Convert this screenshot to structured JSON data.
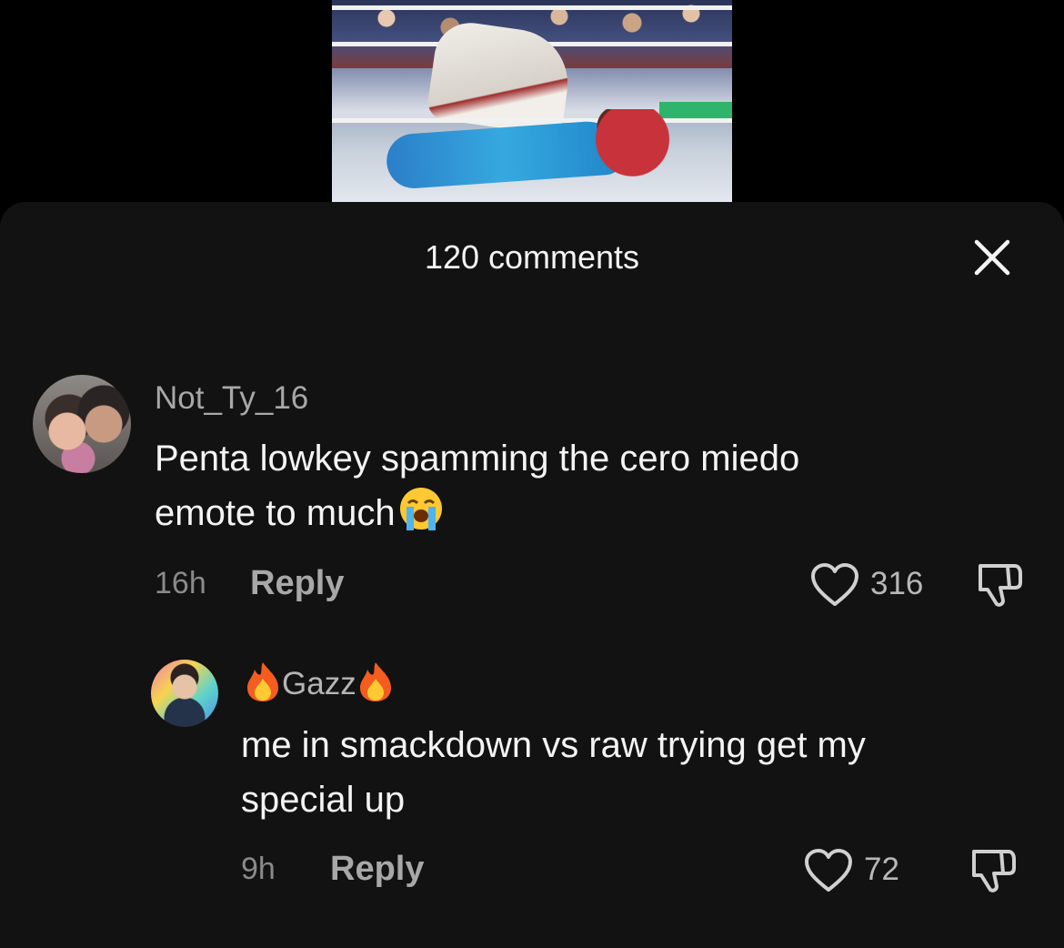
{
  "header": {
    "comment_count": "120 comments"
  },
  "icons": {
    "close": "close-icon",
    "like": "heart-outline-icon",
    "dislike": "thumbs-down-icon",
    "fire": "fire-emoji",
    "crying": "loudly-crying-emoji"
  },
  "comments": [
    {
      "username": "Not_Ty_16",
      "text": "Penta lowkey spamming the cero miedo\nemote to much",
      "time": "16h",
      "reply_label": "Reply",
      "likes": "316"
    },
    {
      "username": "Gazz",
      "text": "me in smackdown vs raw trying get my\nspecial up",
      "time": "9h",
      "reply_label": "Reply",
      "likes": "72"
    }
  ],
  "colors": {
    "sheet_background": "#121212",
    "page_background": "#000000",
    "primary_text": "#f4f4f4",
    "secondary_text": "#a8a8a8"
  }
}
